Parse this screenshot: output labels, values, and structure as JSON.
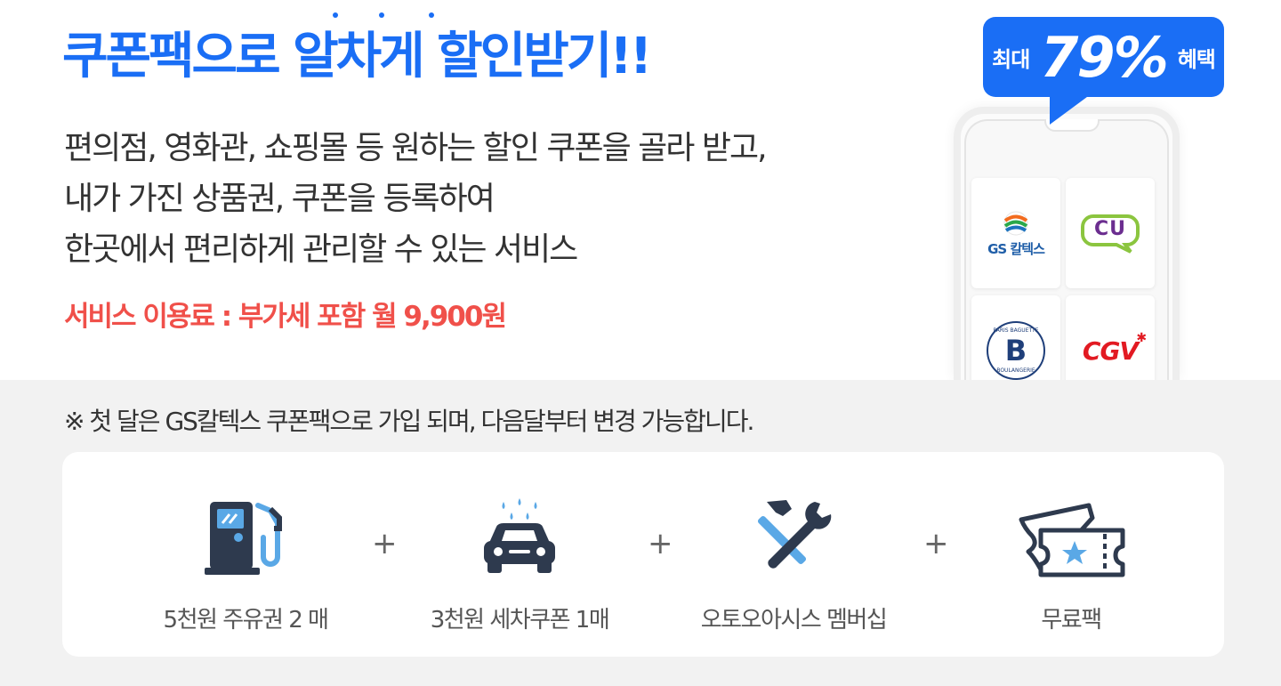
{
  "headline": "쿠폰팩으로 알차게 할인받기!!",
  "description": [
    "편의점, 영화관, 쇼핑몰 등 원하는 할인 쿠폰을 골라 받고,",
    "내가 가진 상품권, 쿠폰을 등록하여",
    "한곳에서 편리하게 관리할 수 있는 서비스"
  ],
  "fee": "서비스 이용료 : 부가세 포함 월 9,900원",
  "badge": {
    "prefix": "최대",
    "value": "79%",
    "suffix": "혜택"
  },
  "phone_tiles": [
    {
      "name": "gs-caltex",
      "text": "GS 칼텍스"
    },
    {
      "name": "cu",
      "text": "CU"
    },
    {
      "name": "paris-baguette",
      "text": "B",
      "ring_top": "PARIS BAGUETTE",
      "ring_bottom": "BOULANGERIE"
    },
    {
      "name": "cgv",
      "text": "CGV"
    }
  ],
  "note": "※ 첫 달은 GS칼텍스 쿠폰팩으로 가입 되며, 다음달부터 변경 가능합니다.",
  "benefits": [
    {
      "icon": "fuel-pump-icon",
      "label": "5천원 주유권 2 매"
    },
    {
      "icon": "car-wash-icon",
      "label": "3천원 세차쿠폰 1매"
    },
    {
      "icon": "wrench-hammer-icon",
      "label": "오토오아시스 멤버십"
    },
    {
      "icon": "ticket-icon",
      "label": "무료팩"
    }
  ],
  "plus_sign": "+",
  "colors": {
    "primary": "#1a6ef5",
    "fee": "#f0504a",
    "icon_dark": "#2e3a4e",
    "icon_light": "#5aa8e6"
  }
}
